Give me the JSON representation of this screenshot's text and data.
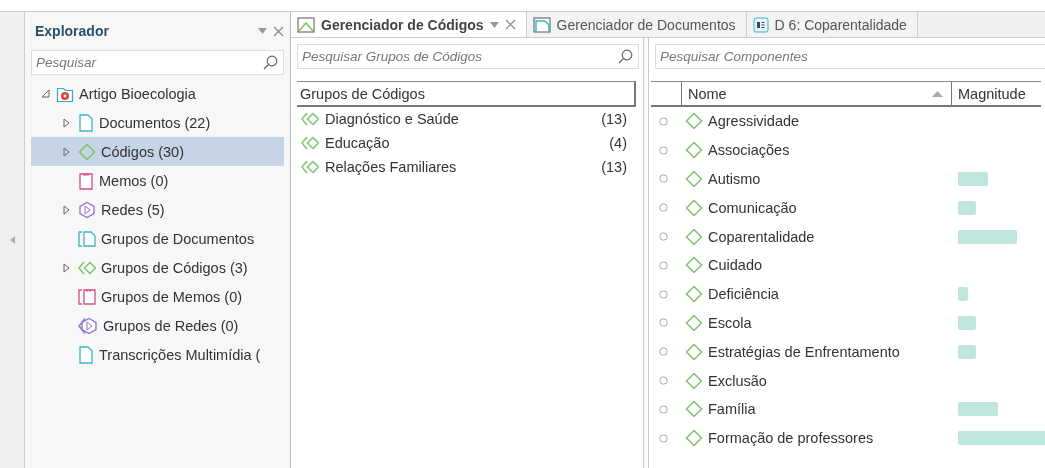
{
  "explorer": {
    "title": "Explorador",
    "search": {
      "placeholder": "Pesquisar"
    },
    "tree": [
      {
        "label": "Artigo Bioecologia",
        "kind": "project",
        "expanded": true,
        "selected": false,
        "children": [
          {
            "label": "Documentos (22)",
            "kind": "documents",
            "expanded": false,
            "selected": false
          },
          {
            "label": "Códigos (30)",
            "kind": "codes",
            "expanded": false,
            "selected": true
          },
          {
            "label": "Memos (0)",
            "kind": "memos",
            "selected": false
          },
          {
            "label": "Redes (5)",
            "kind": "networks",
            "expanded": false,
            "selected": false
          },
          {
            "label": "Grupos de Documentos",
            "kind": "document-groups",
            "selected": false
          },
          {
            "label": "Grupos de Códigos (3)",
            "kind": "code-groups",
            "expanded": false,
            "selected": false
          },
          {
            "label": "Grupos de Memos (0)",
            "kind": "memo-groups",
            "selected": false
          },
          {
            "label": "Grupos de Redes (0)",
            "kind": "network-groups",
            "selected": false
          },
          {
            "label": "Transcrições Multimídia (",
            "kind": "documents",
            "selected": false
          }
        ]
      }
    ]
  },
  "tabs": [
    {
      "label": "Gerenciador de Códigos",
      "kind": "codes",
      "selected": true
    },
    {
      "label": "Gerenciador de Documentos",
      "kind": "documents",
      "selected": false
    },
    {
      "label": "D 6: Coparentalidade",
      "kind": "document",
      "selected": false
    }
  ],
  "groups": {
    "search": {
      "placeholder": "Pesquisar Grupos de Códigos"
    },
    "column": "Grupos de Códigos",
    "rows": [
      {
        "name": "Diagnóstico e Saúde",
        "count": "(13)"
      },
      {
        "name": "Educação",
        "count": "(4)"
      },
      {
        "name": "Relações Familiares",
        "count": "(13)"
      }
    ]
  },
  "components": {
    "search": {
      "placeholder": "Pesquisar Componentes"
    },
    "columns": [
      "Nome",
      "Magnitude"
    ],
    "rows": [
      {
        "name": "Agressividade",
        "kind": "none"
      },
      {
        "name": "Associações",
        "kind": "none"
      },
      {
        "name": "Autismo",
        "kind": "medium"
      },
      {
        "name": "Comunicação",
        "kind": "small"
      },
      {
        "name": "Coparentalidade",
        "kind": "large"
      },
      {
        "name": "Cuidado",
        "kind": "none"
      },
      {
        "name": "Deficiência",
        "kind": "tiny"
      },
      {
        "name": "Escola",
        "kind": "small"
      },
      {
        "name": "Estratégias de Enfrentamento",
        "kind": "small"
      },
      {
        "name": "Exclusão",
        "kind": "none"
      },
      {
        "name": "Família",
        "kind": "wide"
      },
      {
        "name": "Formação de professores",
        "kind": "full"
      }
    ]
  }
}
